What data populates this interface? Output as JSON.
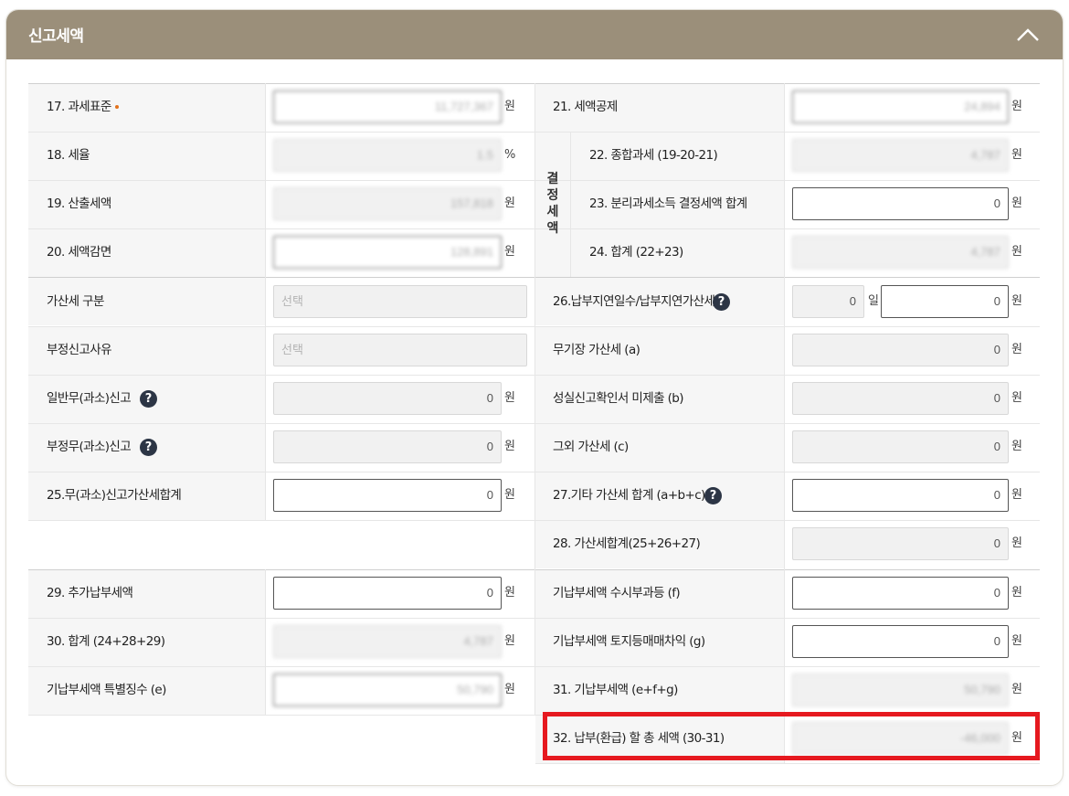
{
  "header": {
    "title": "신고세액"
  },
  "units": {
    "won": "원",
    "percent": "%",
    "day": "일"
  },
  "vertical_group_label": "결\n정\n세\n액",
  "left": [
    {
      "label": "17. 과세표준",
      "value": "11,727,367"
    },
    {
      "label": "18. 세율",
      "value": "1.5"
    },
    {
      "label": "19. 산출세액",
      "value": "157,818"
    },
    {
      "label": "20. 세액감면",
      "value": "128,891"
    },
    {
      "label": "가산세 구분",
      "value": "선택"
    },
    {
      "label": "부정신고사유",
      "value": "선택"
    },
    {
      "label": "일반무(과소)신고",
      "value": "0"
    },
    {
      "label": "부정무(과소)신고",
      "value": "0"
    },
    {
      "label": "25.무(과소)신고가산세합계",
      "value": "0"
    },
    {
      "label": "29. 추가납부세액",
      "value": "0"
    },
    {
      "label": "30. 합계 (24+28+29)",
      "value": "4,787"
    },
    {
      "label": "기납부세액 특별징수 (e)",
      "value": "50,790"
    }
  ],
  "right": [
    {
      "label": "21. 세액공제",
      "value": "24,894"
    },
    {
      "label": "22. 종합과세 (19-20-21)",
      "value": "4,787"
    },
    {
      "label": "23. 분리과세소득 결정세액 합계",
      "value": "0"
    },
    {
      "label": "24. 합계 (22+23)",
      "value": "4,787"
    },
    {
      "label": "26.납부지연일수/납부지연가산세",
      "days": "0",
      "value": "0"
    },
    {
      "label": "무기장 가산세 (a)",
      "value": "0"
    },
    {
      "label": "성실신고확인서 미제출 (b)",
      "value": "0"
    },
    {
      "label": "그외 가산세 (c)",
      "value": "0"
    },
    {
      "label": "27.기타 가산세 합계 (a+b+c)",
      "value": "0"
    },
    {
      "label": "28. 가산세합계(25+26+27)",
      "value": "0"
    },
    {
      "label": "기납부세액 수시부과등 (f)",
      "value": "0"
    },
    {
      "label": "기납부세액 토지등매매차익 (g)",
      "value": "0"
    },
    {
      "label": "31. 기납부세액 (e+f+g)",
      "value": "50,790"
    },
    {
      "label": "32. 납부(환급) 할 총 세액 (30-31)",
      "value": "-46,000"
    }
  ]
}
